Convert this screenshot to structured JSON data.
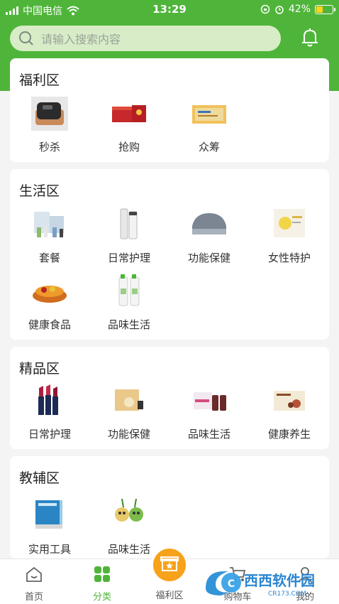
{
  "status_bar": {
    "carrier": "中国电信",
    "time": "13:29",
    "battery_percent": "42%",
    "battery_level": 0.42
  },
  "search": {
    "placeholder": "请输入搜索内容"
  },
  "sections": [
    {
      "title": "福利区",
      "items": [
        {
          "label": "秒杀",
          "icon": "steamer-product-image"
        },
        {
          "label": "抢购",
          "icon": "gift-box-product-image"
        },
        {
          "label": "众筹",
          "icon": "card-box-product-image"
        }
      ]
    },
    {
      "title": "生活区",
      "items": [
        {
          "label": "套餐",
          "icon": "package-set-image"
        },
        {
          "label": "日常护理",
          "icon": "skincare-bottles-image"
        },
        {
          "label": "功能保健",
          "icon": "mattress-image"
        },
        {
          "label": "女性特护",
          "icon": "feminine-care-box-image"
        },
        {
          "label": "健康食品",
          "icon": "fruit-tray-image"
        },
        {
          "label": "品味生活",
          "icon": "detergent-bottles-image"
        }
      ]
    },
    {
      "title": "精品区",
      "items": [
        {
          "label": "日常护理",
          "icon": "lipstick-image"
        },
        {
          "label": "功能保健",
          "icon": "health-box-image"
        },
        {
          "label": "品味生活",
          "icon": "supplement-bottles-image"
        },
        {
          "label": "健康养生",
          "icon": "tea-box-image"
        }
      ]
    },
    {
      "title": "教辅区",
      "items": [
        {
          "label": "实用工具",
          "icon": "books-image"
        },
        {
          "label": "品味生活",
          "icon": "cartoon-fruit-image"
        }
      ]
    }
  ],
  "tabbar": {
    "items": [
      {
        "label": "首页",
        "icon": "home-icon"
      },
      {
        "label": "分类",
        "icon": "category-grid-icon",
        "active": true
      },
      {
        "label": "福利区",
        "icon": "gift-star-icon"
      },
      {
        "label": "购物车",
        "icon": "cart-icon"
      },
      {
        "label": "我的",
        "icon": "user-icon"
      }
    ]
  },
  "watermark": {
    "text": "西西软件园",
    "subtext": "CR173.COM"
  },
  "colors": {
    "brand_green": "#4fb53a",
    "search_bg": "#d8ecc7",
    "badge_orange": "#f7a21b"
  }
}
